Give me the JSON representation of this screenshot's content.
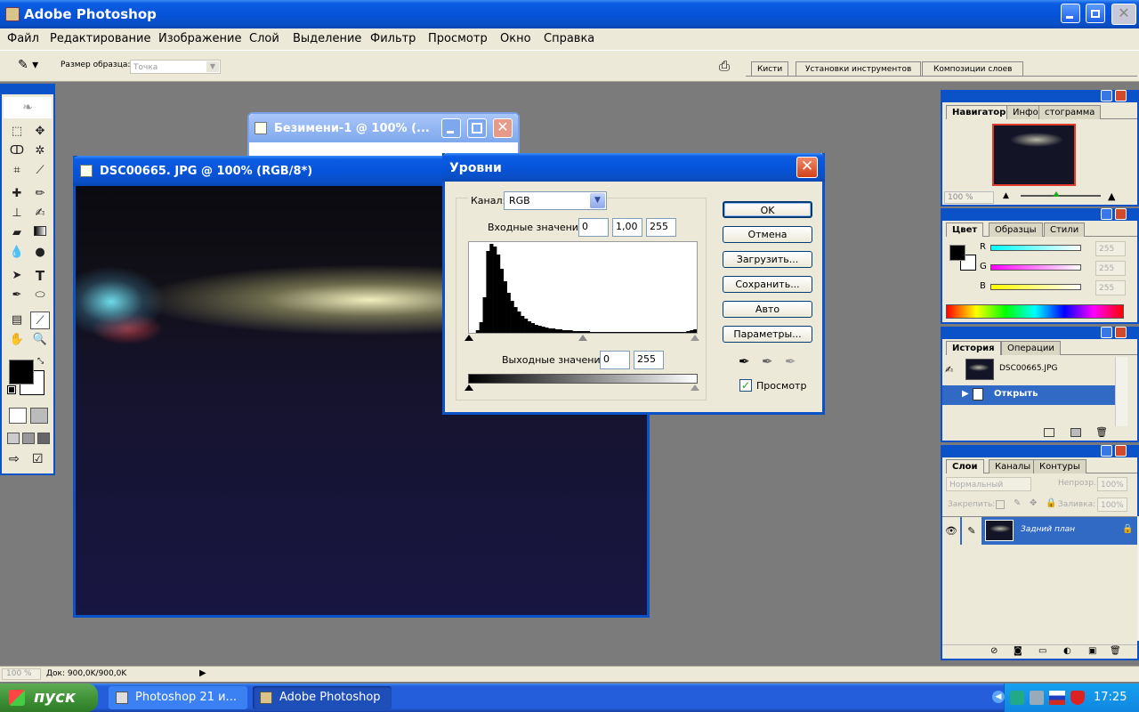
{
  "app": {
    "title": "Adobe Photoshop"
  },
  "menu": [
    "Файл",
    "Редактирование",
    "Изображение",
    "Слой",
    "Выделение",
    "Фильтр",
    "Просмотр",
    "Окно",
    "Справка"
  ],
  "options": {
    "sample_label": "Размер образца:",
    "sample_value": "Точка"
  },
  "palette_well": [
    "Кисти",
    "Установки инструментов",
    "Композиции слоев"
  ],
  "doc_back": {
    "title": "Безимени-1 @ 100% (..."
  },
  "doc_main": {
    "title": "DSC00665. JPG @ 100% (RGB/8*)"
  },
  "levels": {
    "title": "Уровни",
    "channel_label": "Канал:",
    "channel_value": "RGB",
    "input_label": "Входные значения:",
    "input_black": "0",
    "input_gamma": "1,00",
    "input_white": "255",
    "output_label": "Выходные значения:",
    "output_black": "0",
    "output_white": "255",
    "buttons": {
      "ok": "OK",
      "cancel": "Отмена",
      "load": "Загрузить...",
      "save": "Сохранить...",
      "auto": "Авто",
      "options": "Параметры..."
    },
    "preview_label": "Просмотр",
    "preview_checked": true
  },
  "navigator": {
    "tabs": [
      "Навигатор",
      "Инфо",
      "стограмма"
    ],
    "zoom": "100 %"
  },
  "color": {
    "tabs": [
      "Цвет",
      "Образцы",
      "Стили"
    ],
    "r_label": "R",
    "g_label": "G",
    "b_label": "B",
    "r": "255",
    "g": "255",
    "b": "255"
  },
  "history": {
    "tabs": [
      "История",
      "Операции"
    ],
    "snapshot": "DSC00665.JPG",
    "step": "Открыть"
  },
  "layers": {
    "tabs": [
      "Слои",
      "Каналы",
      "Контуры"
    ],
    "mode": "Нормальный",
    "opacity_label": "Непрозр.:",
    "opacity": "100%",
    "lock_label": "Закрепить:",
    "fill_label": "Заливка:",
    "fill": "100%",
    "layer_name": "Задний план"
  },
  "status": {
    "zoom": "100 %",
    "doc": "Док: 900,0K/900,0K"
  },
  "taskbar": {
    "start": "пуск",
    "items": [
      "Photoshop 21 и...",
      "Adobe Photoshop"
    ],
    "clock": "17:25"
  },
  "histogram": [
    0,
    0,
    3,
    12,
    40,
    92,
    100,
    97,
    88,
    72,
    58,
    45,
    36,
    29,
    24,
    19,
    16,
    13,
    11,
    9,
    8,
    7,
    6,
    5,
    5,
    4,
    4,
    3,
    3,
    3,
    2,
    2,
    2,
    2,
    2,
    1,
    1,
    1,
    1,
    1,
    1,
    1,
    1,
    1,
    1,
    1,
    1,
    1,
    1,
    1,
    1,
    1,
    1,
    1,
    1,
    1,
    1,
    1,
    1,
    1,
    1,
    1,
    1,
    2,
    3,
    4
  ]
}
